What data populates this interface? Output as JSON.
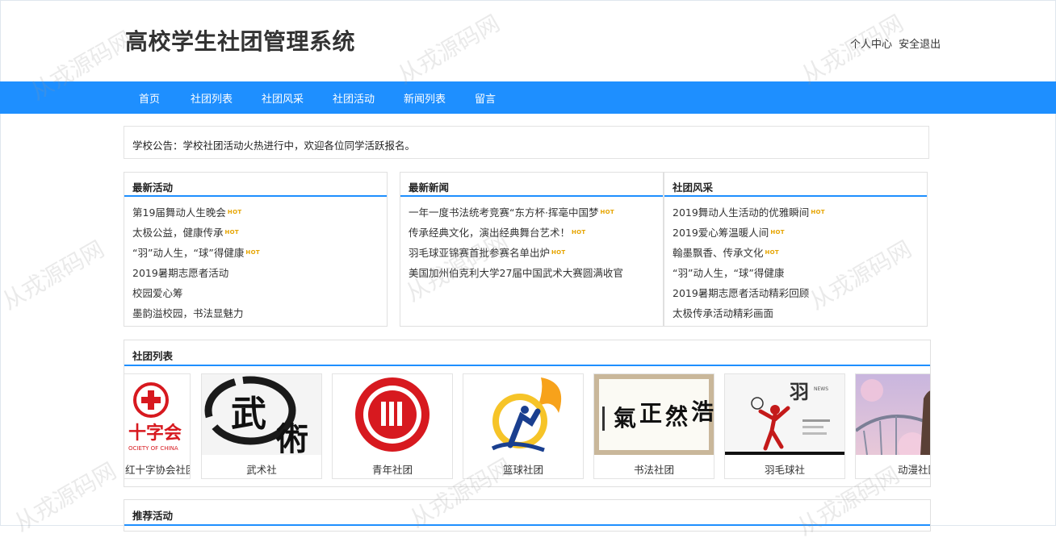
{
  "header": {
    "title": "高校学生社团管理系统",
    "links": [
      "个人中心",
      "安全退出"
    ]
  },
  "nav": {
    "items": [
      "首页",
      "社团列表",
      "社团风采",
      "社团活动",
      "新闻列表",
      "留言"
    ]
  },
  "notice": {
    "text": "学校公告：学校社团活动火热进行中，欢迎各位同学活跃报名。"
  },
  "hot_badge": "HOT",
  "panels": {
    "activities": {
      "title": "最新活动",
      "items": [
        "第19届舞动人生晚会",
        "太极公益，健康传承",
        "“羽”动人生，“球”得健康",
        "2019暑期志愿者活动",
        "校园爱心筹",
        "墨韵溢校园，书法显魅力"
      ],
      "hot": [
        true,
        true,
        true,
        false,
        false,
        false
      ]
    },
    "news": {
      "title": "最新新闻",
      "items": [
        "一年一度书法统考竞赛“东方杯·挥毫中国梦",
        "传承经典文化，演出经典舞台艺术！",
        "羽毛球亚锦赛首批参赛名单出炉",
        "美国加州伯克利大学27届中国武术大赛圆满收官"
      ],
      "hot": [
        true,
        true,
        true,
        false
      ]
    },
    "style": {
      "title": "社团风采",
      "items": [
        "2019舞动人生活动的优雅瞬间",
        "2019爱心筹温暖人间",
        "翰墨飘香、传承文化",
        "“羽”动人生，“球”得健康",
        "2019暑期志愿者活动精彩回顾",
        "太极传承活动精彩画面"
      ],
      "hot": [
        true,
        true,
        true,
        false,
        false,
        false
      ]
    }
  },
  "club_list": {
    "title": "社团列表",
    "clubs": [
      {
        "name": "红十字协会社团",
        "image_text": [
          "十字会",
          "OCIETY OF CHINA"
        ]
      },
      {
        "name": "武术社",
        "image_text": [
          "武",
          "術"
        ]
      },
      {
        "name": "青年社团",
        "image_text": []
      },
      {
        "name": "篮球社团",
        "image_text": []
      },
      {
        "name": "书法社团",
        "image_text": [
          "浩",
          "然",
          "正",
          "氣"
        ]
      },
      {
        "name": "羽毛球社",
        "image_text": [
          "羽",
          "NEWS"
        ]
      },
      {
        "name": "动漫社团",
        "image_text": []
      }
    ]
  },
  "recommended": {
    "title": "推荐活动"
  },
  "watermark_text": "从戎源码网",
  "colors": {
    "nav_bg": "#1e8fff",
    "accent_line": "#1e8fff",
    "hot_badge": "#e6a400",
    "red_cross": "#d7191f"
  }
}
